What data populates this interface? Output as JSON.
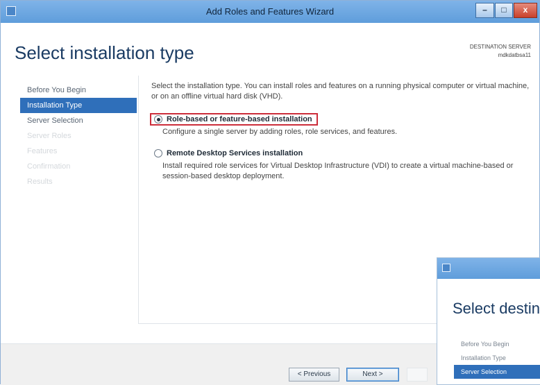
{
  "window": {
    "title": "Add Roles and Features Wizard",
    "controls": {
      "minimize": "–",
      "maximize": "□",
      "close": "x"
    }
  },
  "header": {
    "page_title": "Select installation type",
    "destination_label": "DESTINATION SERVER",
    "destination_name": "mdkdatbsa11"
  },
  "nav": {
    "items": [
      {
        "label": "Before You Begin",
        "state": "normal"
      },
      {
        "label": "Installation Type",
        "state": "selected"
      },
      {
        "label": "Server Selection",
        "state": "normal"
      },
      {
        "label": "Server Roles",
        "state": "disabled"
      },
      {
        "label": "Features",
        "state": "disabled"
      },
      {
        "label": "Confirmation",
        "state": "disabled"
      },
      {
        "label": "Results",
        "state": "disabled"
      }
    ]
  },
  "content": {
    "description": "Select the installation type. You can install roles and features on a running physical computer or virtual machine, or on an offline virtual hard disk (VHD).",
    "options": [
      {
        "label": "Role-based or feature-based installation",
        "description": "Configure a single server by adding roles, role services, and features.",
        "selected": true
      },
      {
        "label": "Remote Desktop Services installation",
        "description": "Install required role services for Virtual Desktop Infrastructure (VDI) to create a virtual machine-based or session-based desktop deployment.",
        "selected": false
      }
    ]
  },
  "footer": {
    "previous_label": "< Previous",
    "next_label": "Next >"
  },
  "sub_window": {
    "title": "Select destina",
    "nav": [
      {
        "label": "Before You Begin",
        "state": "normal"
      },
      {
        "label": "Installation Type",
        "state": "normal"
      },
      {
        "label": "Server Selection",
        "state": "selected"
      }
    ]
  },
  "colors": {
    "accent": "#2f6fba",
    "highlight_box": "#cc2d3a",
    "title_blue": "#1a3b63"
  }
}
